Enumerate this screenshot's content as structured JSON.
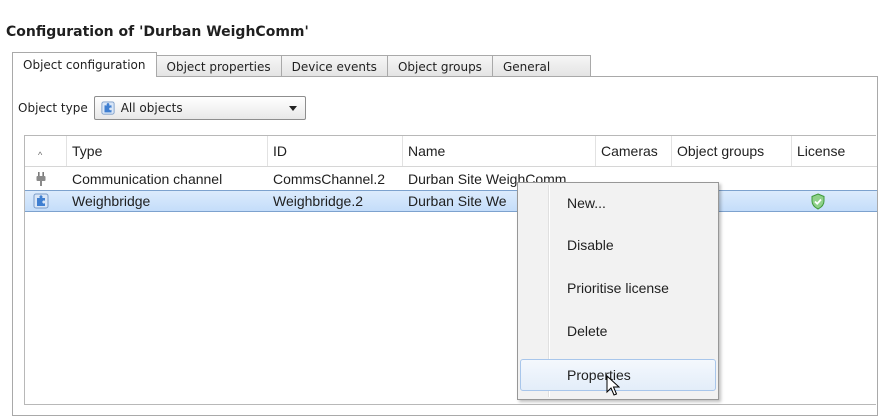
{
  "window": {
    "title": "Configuration of 'Durban WeighComm'"
  },
  "tabs": [
    {
      "label": "Object configuration",
      "active": true
    },
    {
      "label": "Object properties",
      "active": false
    },
    {
      "label": "Device events",
      "active": false
    },
    {
      "label": "Object groups",
      "active": false
    },
    {
      "label": "General",
      "active": false
    }
  ],
  "filter": {
    "label": "Object type",
    "selected": "All objects",
    "icon": "puzzle-icon"
  },
  "table": {
    "columns": [
      "Type",
      "ID",
      "Name",
      "Cameras",
      "Object groups",
      "License"
    ],
    "rows": [
      {
        "icon": "plug-icon",
        "type": "Communication channel",
        "id": "CommsChannel.2",
        "name": "Durban Site WeighComm",
        "cameras": "",
        "object_groups": "",
        "license": ""
      },
      {
        "icon": "puzzle-icon",
        "type": "Weighbridge",
        "id": "Weighbridge.2",
        "name": "Durban Site We",
        "cameras": "",
        "object_groups": "",
        "license": "shield-check-icon",
        "selected": true
      }
    ]
  },
  "context_menu": {
    "items": [
      {
        "label": "New..."
      },
      {
        "label": "Disable"
      },
      {
        "label": "Prioritise license"
      },
      {
        "label": "Delete"
      },
      {
        "label": "Properties",
        "hovered": true
      }
    ]
  },
  "colors": {
    "selection": "#c4ddfa",
    "selection_border": "#7da2ce",
    "menu_bg": "#f2f2f2",
    "menu_hover_border": "#a8c6eb",
    "license_ok": "#4caf50"
  }
}
